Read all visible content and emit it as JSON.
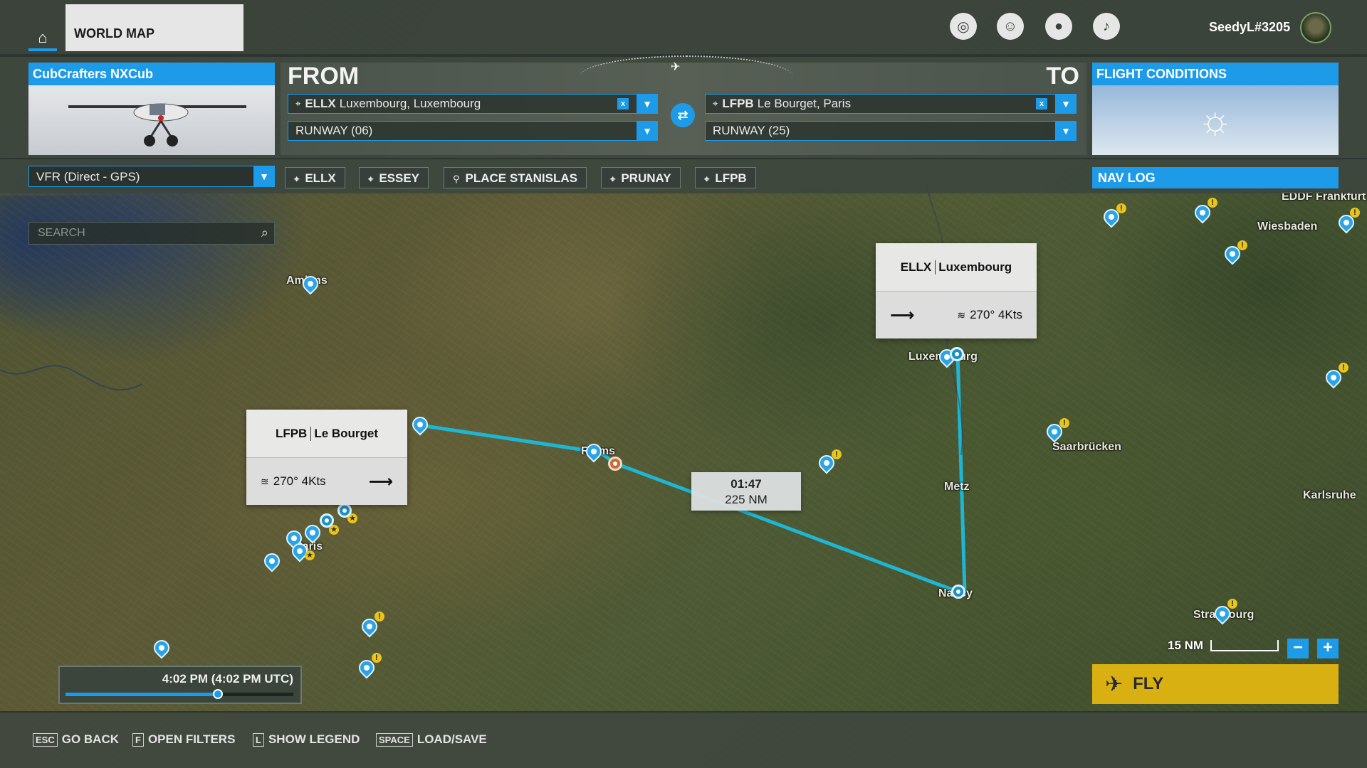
{
  "topbar": {
    "world_map_label": "WORLD MAP",
    "username": "SeedyL#3205",
    "icons": [
      "home-icon",
      "activity-icon",
      "friends-icon",
      "profile-icon",
      "bell-icon"
    ]
  },
  "aircraft": {
    "name": "CubCrafters NXCub"
  },
  "route": {
    "from_label": "FROM",
    "to_label": "TO",
    "from_icao": "ELLX",
    "from_name": "Luxembourg, Luxembourg",
    "to_icao": "LFPB",
    "to_name": "Le Bourget, Paris",
    "from_runway": "RUNWAY (06)",
    "to_runway": "RUNWAY (25)",
    "clear_glyph": "x",
    "swap_glyph": "⇄"
  },
  "conditions": {
    "title": "FLIGHT CONDITIONS"
  },
  "flightplan": {
    "type": "VFR (Direct - GPS)",
    "waypoints": [
      "ELLX",
      "ESSEY",
      "PLACE STANISLAS",
      "PRUNAY",
      "LFPB"
    ],
    "navlog_label": "NAV LOG"
  },
  "search": {
    "placeholder": "SEARCH"
  },
  "map": {
    "places": {
      "amiens": "Amiens",
      "reims": "Reims",
      "luxembourg": "Luxembourg",
      "metz": "Metz",
      "nancy": "Nancy",
      "saarbrucken": "Saarbrücken",
      "wiesbaden": "Wiesbaden",
      "karlsruhe": "Karlsruhe",
      "strasbourg": "Strasbourg",
      "paris": "Paris",
      "frankfurt": "EDDF Frankfurt"
    },
    "card_ellx": {
      "icao": "ELLX",
      "name": "Luxembourg",
      "wind": "270° 4Kts"
    },
    "card_lfpb": {
      "icao": "LFPB",
      "name": "Le Bourget",
      "wind": "270° 4Kts"
    },
    "leg": {
      "time": "01:47",
      "distance": "225 NM"
    }
  },
  "time": {
    "label": "4:02 PM (4:02 PM UTC)",
    "slider_position": 0.67
  },
  "scale": {
    "label": "15 NM"
  },
  "fly": {
    "label": "FLY"
  },
  "bottombar": {
    "hints": [
      {
        "key": "ESC",
        "label": "GO BACK"
      },
      {
        "key": "F",
        "label": "OPEN FILTERS"
      },
      {
        "key": "L",
        "label": "SHOW LEGEND"
      },
      {
        "key": "SPACE",
        "label": "LOAD/SAVE"
      }
    ]
  },
  "colors": {
    "accent": "#1e9be8",
    "fly": "#d9b012",
    "route": "#1fb6d4"
  }
}
